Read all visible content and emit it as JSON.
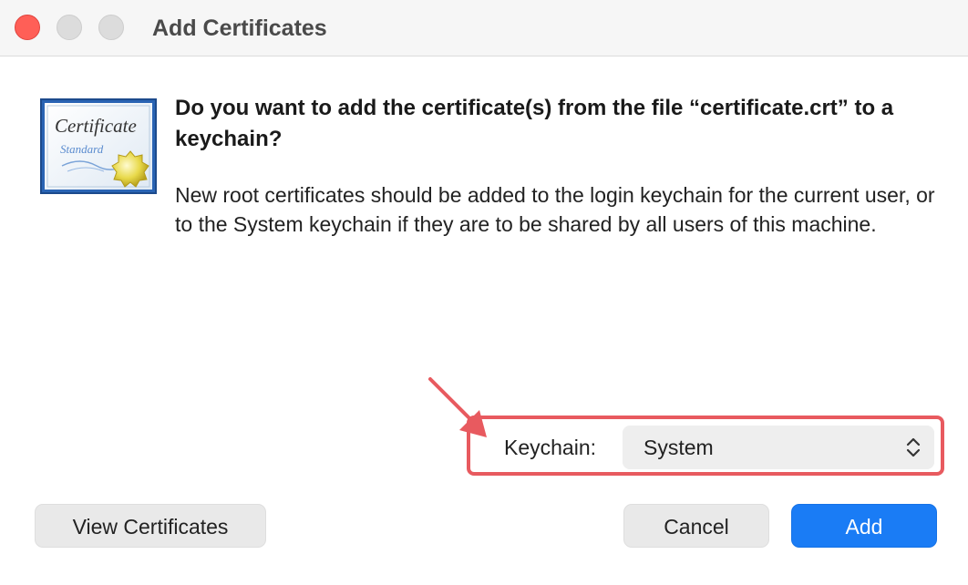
{
  "window": {
    "title": "Add Certificates"
  },
  "dialog": {
    "heading": "Do you want to add the certificate(s) from the file “certificate.crt” to a keychain?",
    "body": "New root certificates should be added to the login keychain for the current user, or to the System keychain if they are to be shared by all users of this machine.",
    "icon": {
      "name": "certificate-icon",
      "text_main": "Certificate",
      "text_sub": "Standard"
    }
  },
  "keychain": {
    "label": "Keychain:",
    "selected": "System"
  },
  "buttons": {
    "view_certificates": "View Certificates",
    "cancel": "Cancel",
    "add": "Add"
  },
  "colors": {
    "accent": "#1a7cf5",
    "annotation": "#e85a5f",
    "close": "#ff5f57"
  }
}
